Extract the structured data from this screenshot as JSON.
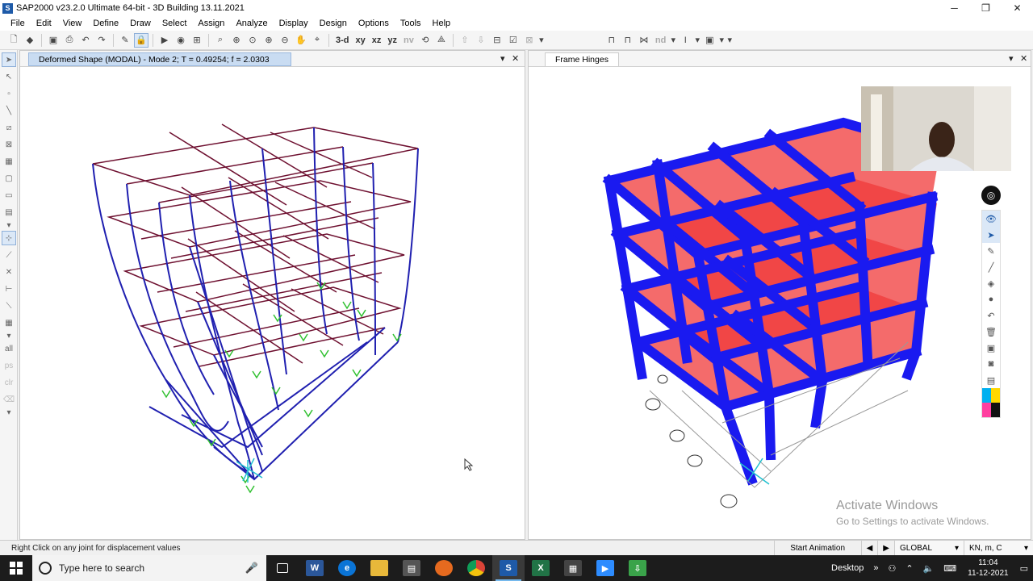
{
  "window": {
    "app_icon": "S",
    "title": "SAP2000 v23.2.0 Ultimate 64-bit - 3D Building 13.11.2021",
    "minimize": "─",
    "maximize": "❐",
    "close": "✕"
  },
  "menu": [
    "File",
    "Edit",
    "View",
    "Define",
    "Draw",
    "Select",
    "Assign",
    "Analyze",
    "Display",
    "Design",
    "Options",
    "Tools",
    "Help"
  ],
  "toolbar": {
    "view_3d": "3-d",
    "view_xy": "xy",
    "view_xz": "xz",
    "view_yz": "yz",
    "view_nv": "nv",
    "view_nd": "nd"
  },
  "left_panel": {
    "tab_title": "Deformed Shape (MODAL) - Mode 2; T = 0.49254;  f = 2.0303"
  },
  "right_panel": {
    "tab_title": "Frame Hinges"
  },
  "panel_controls": {
    "dropdown": "▾",
    "close": "✕"
  },
  "annotation_tools": {
    "pin_icon": "pin-icon",
    "colors": [
      "#00b0f0",
      "#ffd800",
      "#ff3fa0",
      "#111111"
    ]
  },
  "watermark": {
    "title": "Activate Windows",
    "subtitle": "Go to Settings to activate Windows."
  },
  "status": {
    "message": "Right Click on any joint for displacement values",
    "animation_button": "Start Animation",
    "prev": "◀",
    "next": "▶",
    "coord_system": "GLOBAL",
    "units": "KN, m, C"
  },
  "taskbar": {
    "search_placeholder": "Type here to search",
    "desktop_label": "Desktop",
    "time": "11:04",
    "date": "11-12-2021"
  }
}
